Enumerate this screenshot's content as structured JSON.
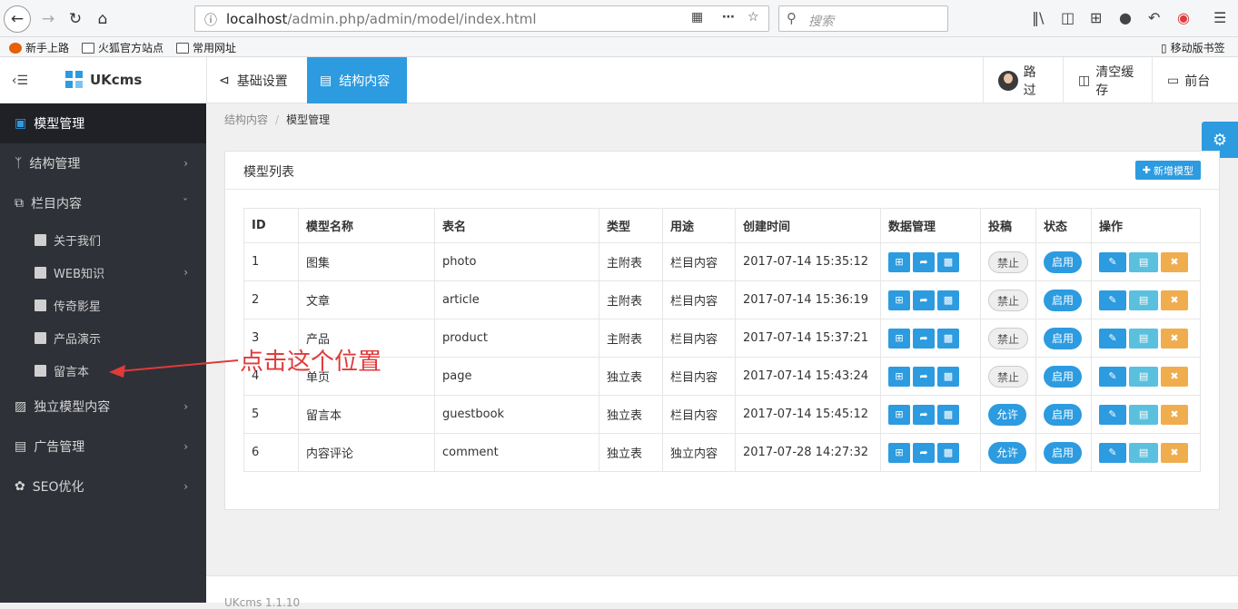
{
  "browser": {
    "url_host": "localhost",
    "url_path": "/admin.php/admin/model/index.html",
    "search_placeholder": "搜索",
    "bookmarks": [
      "新手上路",
      "火狐官方站点",
      "常用网址"
    ],
    "mobile_bookmarks": "移动版书签"
  },
  "header": {
    "logo": "UKcms",
    "tabs": [
      "基础设置",
      "结构内容"
    ],
    "active_tab": "结构内容",
    "user": "路过",
    "clear_cache": "清空缓存",
    "frontend": "前台",
    "accent_color": "#2c9be0"
  },
  "sidebar": {
    "items": [
      {
        "label": "模型管理",
        "icon": "cube-icon",
        "active": true
      },
      {
        "label": "结构管理",
        "icon": "branch-icon"
      },
      {
        "label": "栏目内容",
        "icon": "copy-icon",
        "expanded": true
      },
      {
        "label": "独立模型内容",
        "icon": "briefcase-icon"
      },
      {
        "label": "广告管理",
        "icon": "image-icon"
      },
      {
        "label": "SEO优化",
        "icon": "paw-icon"
      }
    ],
    "sub_items": [
      "关于我们",
      "WEB知识",
      "传奇影星",
      "产品演示",
      "留言本"
    ]
  },
  "breadcrumb": {
    "parent": "结构内容",
    "current": "模型管理"
  },
  "panel": {
    "title": "模型列表",
    "add_button": "新增模型",
    "columns": [
      "ID",
      "模型名称",
      "表名",
      "类型",
      "用途",
      "创建时间",
      "数据管理",
      "投稿",
      "状态",
      "操作"
    ],
    "rows": [
      {
        "id": "1",
        "name": "图集",
        "table": "photo",
        "type": "主附表",
        "use": "栏目内容",
        "created": "2017-07-14 15:35:12",
        "submit": "禁止",
        "status": "启用"
      },
      {
        "id": "2",
        "name": "文章",
        "table": "article",
        "type": "主附表",
        "use": "栏目内容",
        "created": "2017-07-14 15:36:19",
        "submit": "禁止",
        "status": "启用"
      },
      {
        "id": "3",
        "name": "产品",
        "table": "product",
        "type": "主附表",
        "use": "栏目内容",
        "created": "2017-07-14 15:37:21",
        "submit": "禁止",
        "status": "启用"
      },
      {
        "id": "4",
        "name": "单页",
        "table": "page",
        "type": "独立表",
        "use": "栏目内容",
        "created": "2017-07-14 15:43:24",
        "submit": "禁止",
        "status": "启用"
      },
      {
        "id": "5",
        "name": "留言本",
        "table": "guestbook",
        "type": "独立表",
        "use": "栏目内容",
        "created": "2017-07-14 15:45:12",
        "submit": "允许",
        "status": "启用"
      },
      {
        "id": "6",
        "name": "内容评论",
        "table": "comment",
        "type": "独立表",
        "use": "独立内容",
        "created": "2017-07-28 14:27:32",
        "submit": "允许",
        "status": "启用"
      }
    ]
  },
  "annotation": "点击这个位置",
  "footer": "UKcms 1.1.10"
}
